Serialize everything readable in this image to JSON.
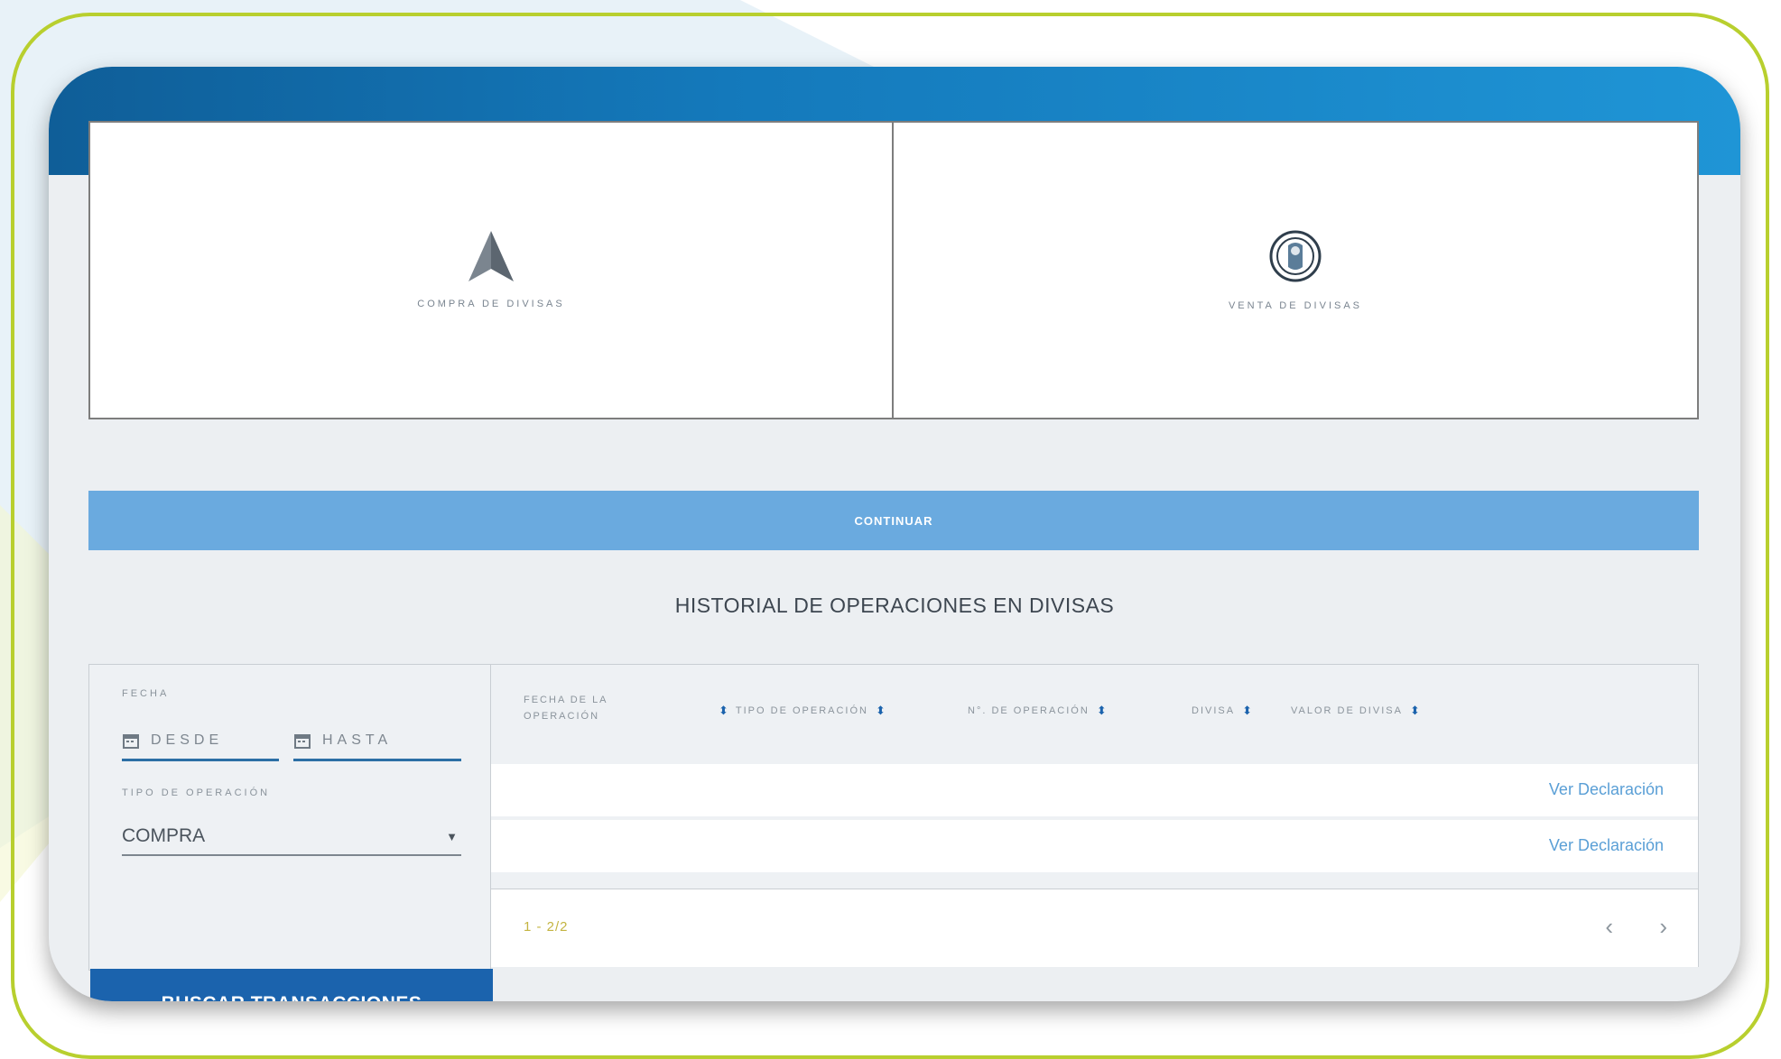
{
  "operations": [
    {
      "label": "COMPRA DE DIVISAS",
      "icon": "arrow-up-icon"
    },
    {
      "label": "VENTA DE DIVISAS",
      "icon": "coin-icon"
    }
  ],
  "continue_label": "CONTINUAR",
  "history_title": "HISTORIAL DE OPERACIONES EN DIVISAS",
  "filters": {
    "date_label": "FECHA",
    "from_placeholder": "DESDE",
    "to_placeholder": "HASTA",
    "type_label": "TIPO DE OPERACIÓN",
    "type_value": "COMPRA",
    "search_button": "BUSCAR TRANSACCIONES"
  },
  "table": {
    "columns": [
      {
        "label": "FECHA DE LA OPERACIÓN"
      },
      {
        "label": "TIPO DE OPERACIÓN"
      },
      {
        "label": "N°. DE OPERACIÓN"
      },
      {
        "label": "DIVISA"
      },
      {
        "label": "VALOR DE DIVISA"
      }
    ],
    "rows": [
      {
        "link": "Ver Declaración"
      },
      {
        "link": "Ver Declaración"
      }
    ],
    "pagination": "1 - 2/2",
    "prev": "‹",
    "next": "›"
  },
  "colors": {
    "header_blue": "#1479bb",
    "continue_bar": "#6aaadf",
    "search_button": "#1b63ad",
    "frame_green": "#b8cf2e"
  }
}
